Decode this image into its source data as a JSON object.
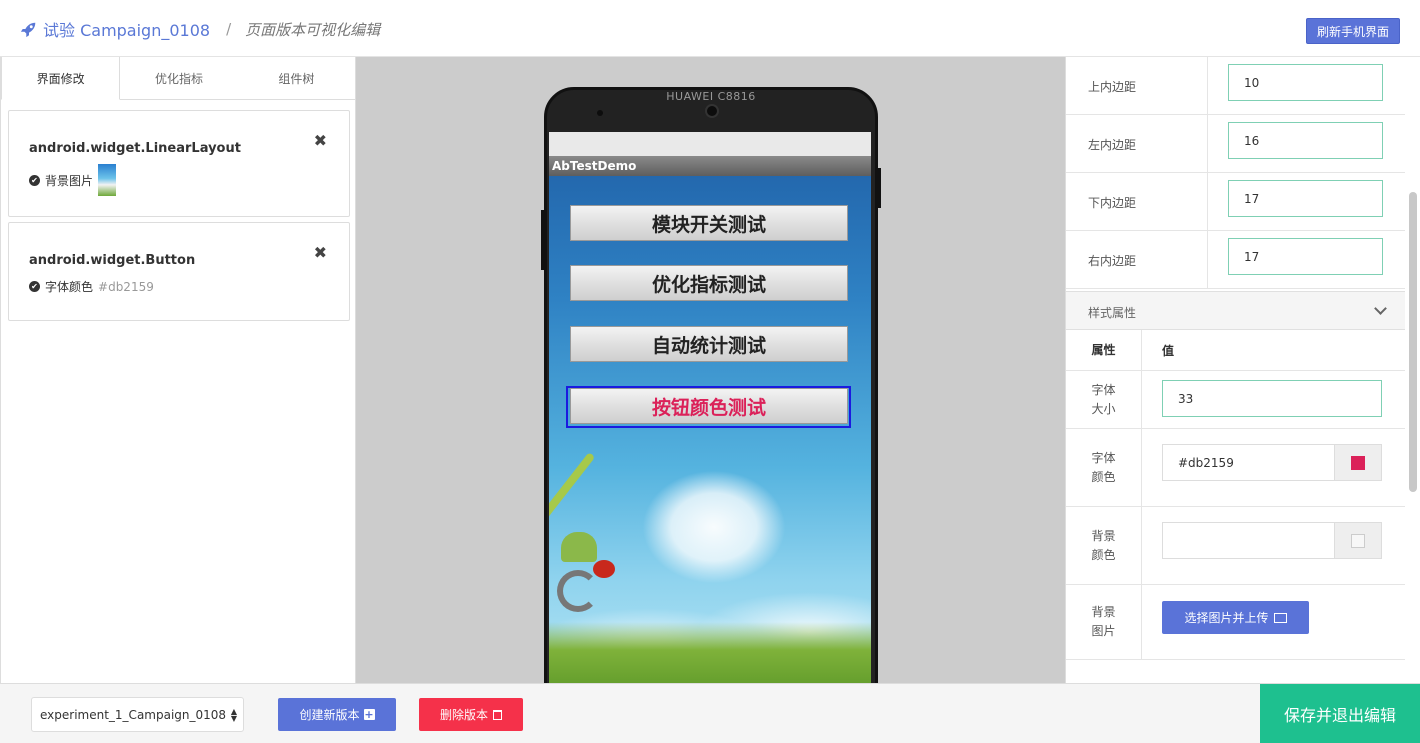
{
  "header": {
    "breadcrumb_link": "试验 Campaign_0108",
    "breadcrumb_sep": "/",
    "breadcrumb_current": "页面版本可视化编辑",
    "refresh_label": "刷新手机界面",
    "rocket_icon": "rocket-icon"
  },
  "tabs": [
    {
      "label": "界面修改",
      "active": true
    },
    {
      "label": "优化指标",
      "active": false
    },
    {
      "label": "组件树",
      "active": false
    }
  ],
  "changes": [
    {
      "title": "android.widget.LinearLayout",
      "prop_label": "背景图片",
      "prop_value": ""
    },
    {
      "title": "android.widget.Button",
      "prop_label": "字体颜色",
      "prop_value": "#db2159"
    }
  ],
  "phone": {
    "model": "HUAWEI C8816",
    "app_title": "AbTestDemo",
    "buttons": [
      "模块开关测试",
      "优化指标测试",
      "自动统计测试",
      "按钮颜色测试"
    ],
    "selected_button_index": 3
  },
  "padding_props": [
    {
      "label": "上内边距",
      "value": "10"
    },
    {
      "label": "左内边距",
      "value": "16"
    },
    {
      "label": "下内边距",
      "value": "17"
    },
    {
      "label": "右内边距",
      "value": "17"
    }
  ],
  "style_section": {
    "title": "样式属性",
    "col_attr": "属性",
    "col_value": "值",
    "font_size_label": "字体\n大小",
    "font_size_value": "33",
    "font_color_label": "字体\n颜色",
    "font_color_value": "#db2159",
    "bg_color_label": "背景\n颜色",
    "bg_color_value": "",
    "bg_image_label": "背景\n图片",
    "upload_label": "选择图片并上传"
  },
  "colors": {
    "accent": "#5a73d8",
    "selected_font_color": "#db2159",
    "save_green": "#1ec08f",
    "delete_red": "#f5314a"
  },
  "bottom": {
    "version_selected": "experiment_1_Campaign_0108",
    "create_label": "创建新版本",
    "delete_label": "删除版本",
    "save_label": "保存并退出编辑"
  }
}
